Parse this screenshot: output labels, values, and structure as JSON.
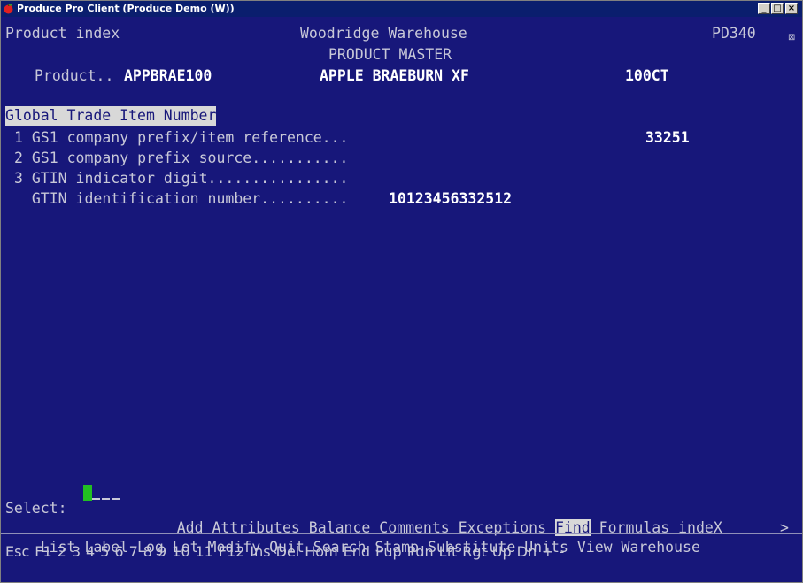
{
  "window": {
    "title": "Produce Pro Client (Produce Demo (W))",
    "minimize": "_",
    "maximize": "□",
    "close": "×"
  },
  "header": {
    "screen_name": "Product index",
    "company": "Woodridge Warehouse",
    "subtitle": "PRODUCT MASTER",
    "program_code": "PD340",
    "close_box": "⊠"
  },
  "product": {
    "label": "Product..",
    "code": "APPBRAE100",
    "description": "APPLE BRAEBURN XF",
    "pack": "100CT"
  },
  "section": {
    "title": "Global Trade Item Number",
    "fields": [
      {
        "label": "1 GS1 company prefix/item reference...",
        "value": "33251"
      },
      {
        "label": "2 GS1 company prefix source...........",
        "value": ""
      },
      {
        "label": "3 GTIN indicator digit................",
        "value": ""
      },
      {
        "label": "  GTIN identification number..........",
        "value": "10123456332512"
      }
    ]
  },
  "command": {
    "prompt": "Select:",
    "row1": [
      "Add",
      "Attributes",
      "Balance",
      "Comments",
      "Exceptions",
      "Find",
      "Formulas",
      "indeX"
    ],
    "row2": [
      "List",
      "Label",
      "Log",
      "Lot",
      "Modify",
      "Quit",
      "Search",
      "Stamp",
      "Substitute",
      "Units",
      "View",
      "Warehouse"
    ],
    "more": ">"
  },
  "function_keys": [
    "Esc",
    "F1",
    "2",
    "3",
    "4",
    "5",
    "6",
    "7",
    "8",
    "9",
    "10",
    "11",
    "F12",
    "Ins",
    "Del",
    "Hom",
    "End",
    "Pup",
    "Pdn",
    "Lft",
    "Rgt",
    "Up",
    "Dn",
    "+",
    "-"
  ]
}
